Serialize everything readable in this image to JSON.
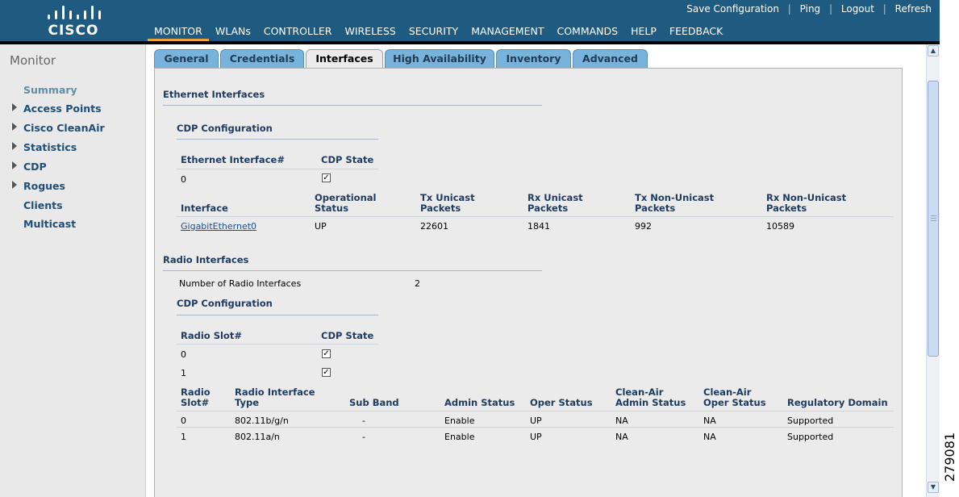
{
  "brand": {
    "logo_text": "CISCO"
  },
  "util_links": [
    "Save Configuration",
    "Ping",
    "Logout",
    "Refresh"
  ],
  "nav": [
    "MONITOR",
    "WLANs",
    "CONTROLLER",
    "WIRELESS",
    "SECURITY",
    "MANAGEMENT",
    "COMMANDS",
    "HELP",
    "FEEDBACK"
  ],
  "nav_active": "MONITOR",
  "sidebar": {
    "title": "Monitor",
    "items": [
      {
        "label": "Summary",
        "expandable": false
      },
      {
        "label": "Access Points",
        "expandable": true
      },
      {
        "label": "Cisco CleanAir",
        "expandable": true
      },
      {
        "label": "Statistics",
        "expandable": true
      },
      {
        "label": "CDP",
        "expandable": true
      },
      {
        "label": "Rogues",
        "expandable": true
      },
      {
        "label": "Clients",
        "expandable": false
      },
      {
        "label": "Multicast",
        "expandable": false
      }
    ]
  },
  "tabs": [
    "General",
    "Credentials",
    "Interfaces",
    "High Availability",
    "Inventory",
    "Advanced"
  ],
  "active_tab": "Interfaces",
  "ethernet": {
    "title": "Ethernet Interfaces",
    "cdp_title": "CDP Configuration",
    "cdp_headers": [
      "Ethernet Interface#",
      "CDP State"
    ],
    "cdp_rows": [
      {
        "id": "0",
        "checked": true
      }
    ],
    "stats_headers": {
      "interface": "Interface",
      "operational_status": [
        "Operational",
        "Status"
      ],
      "tx_unicast": [
        "Tx Unicast",
        "Packets"
      ],
      "rx_unicast": [
        "Rx Unicast",
        "Packets"
      ],
      "tx_non_unicast": [
        "Tx Non-Unicast",
        "Packets"
      ],
      "rx_non_unicast": [
        "Rx Non-Unicast",
        "Packets"
      ]
    },
    "stats_rows": [
      {
        "interface": "GigabitEthernet0",
        "status": "UP",
        "tx_unicast": "22601",
        "rx_unicast": "1841",
        "tx_non_unicast": "992",
        "rx_non_unicast": "10589"
      }
    ]
  },
  "radio": {
    "title": "Radio Interfaces",
    "count_label": "Number of Radio Interfaces",
    "count_value": "2",
    "cdp_title": "CDP Configuration",
    "cdp_headers": [
      "Radio Slot#",
      "CDP State"
    ],
    "cdp_rows": [
      {
        "id": "0",
        "checked": true
      },
      {
        "id": "1",
        "checked": true
      }
    ],
    "table_headers": {
      "slot": [
        "Radio",
        "Slot#"
      ],
      "type": [
        "Radio Interface",
        "Type"
      ],
      "sub_band": "Sub Band",
      "admin_status": "Admin Status",
      "oper_status": "Oper Status",
      "cleanair_admin": [
        "Clean-Air",
        "Admin Status"
      ],
      "cleanair_oper": [
        "Clean-Air",
        "Oper Status"
      ],
      "regulatory": "Regulatory Domain"
    },
    "table_rows": [
      {
        "slot": "0",
        "type": "802.11b/g/n",
        "sub_band": "-",
        "admin": "Enable",
        "oper": "UP",
        "ca_admin": "NA",
        "ca_oper": "NA",
        "regulatory": "Supported"
      },
      {
        "slot": "1",
        "type": "802.11a/n",
        "sub_band": "-",
        "admin": "Enable",
        "oper": "UP",
        "ca_admin": "NA",
        "ca_oper": "NA",
        "regulatory": "Supported"
      }
    ]
  },
  "figure_number": "279081",
  "colors": {
    "header_bg": "#1f5b80",
    "tab_bg": "#78b3dc",
    "accent": "#f1a33b",
    "panel_bg": "#ebebeb"
  }
}
